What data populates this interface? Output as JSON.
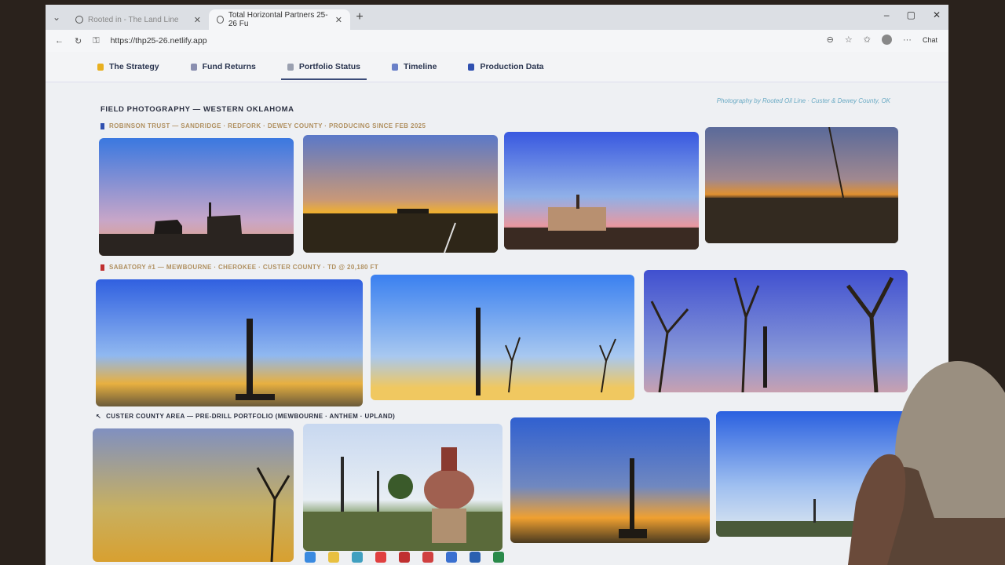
{
  "browser": {
    "tabs": [
      {
        "label": "Rooted in - The Land Line",
        "active": false
      },
      {
        "label": "Total Horizontal Partners 25-26 Fu",
        "active": true
      }
    ],
    "new_tab": "+",
    "url": "https://thp25-26.netlify.app",
    "chat_label": "Chat",
    "window_controls": [
      "–",
      "▢",
      "✕"
    ]
  },
  "nav": {
    "items": [
      {
        "label": "The Strategy",
        "icon": "bulb-icon",
        "color": "#e8b020"
      },
      {
        "label": "Fund Returns",
        "icon": "chart-icon",
        "color": "#8a8fb0"
      },
      {
        "label": "Portfolio Status",
        "icon": "clipboard-icon",
        "color": "#9aa0b0",
        "active": true
      },
      {
        "label": "Timeline",
        "icon": "calendar-icon",
        "color": "#6a80c8"
      },
      {
        "label": "Production Data",
        "icon": "bar-icon",
        "color": "#3050b0"
      }
    ]
  },
  "gallery": {
    "title": "FIELD PHOTOGRAPHY — WESTERN OKLAHOMA",
    "credit": "Photography by Rooted Oil Line · Custer & Dewey County, OK",
    "sections": [
      {
        "heading": "ROBINSON TRUST — SANDRIDGE · REDFORK · DEWEY COUNTY · PRODUCING SINCE FEB 2025",
        "color": "#3050b0"
      },
      {
        "heading": "SABATORY #1 — MEWBOURNE · CHEROKEE · CUSTER COUNTY · TD @ 20,180 FT",
        "color": "#c03030"
      },
      {
        "heading": "CUSTER COUNTY AREA — PRE-DRILL PORTFOLIO (MEWBOURNE · ANTHEM · UPLAND)",
        "color": "#555555"
      }
    ]
  },
  "colors": {
    "accent": "#3b4b78",
    "sky_blue": "#3a78e0",
    "sunset": "#f0a030"
  }
}
